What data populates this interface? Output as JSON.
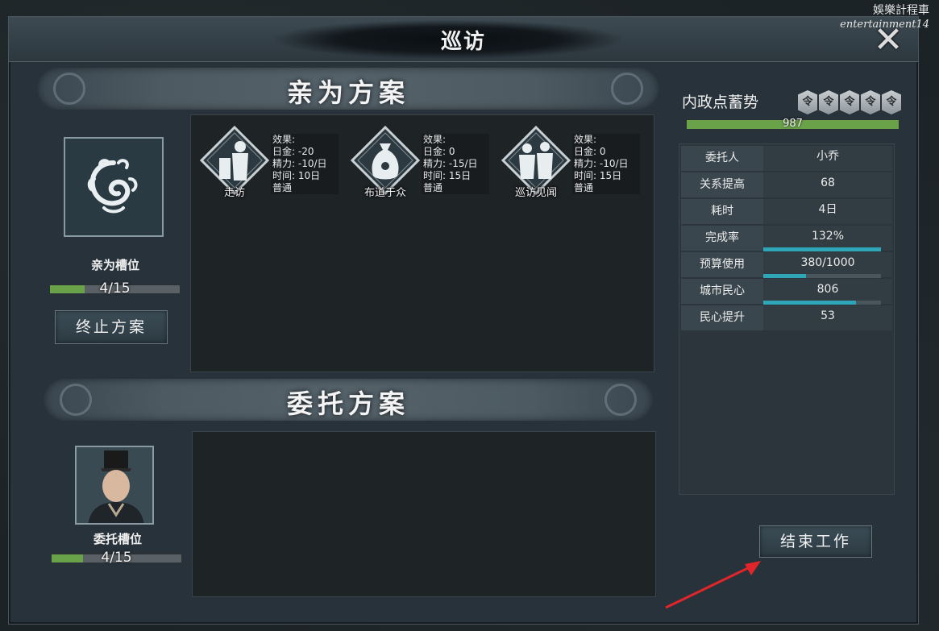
{
  "window": {
    "title": "巡访",
    "watermark_line1": "娛樂計程車",
    "watermark_line2": "entertainment14",
    "close_glyph": "✕"
  },
  "personal": {
    "header": "亲为方案",
    "slot_label": "亲为槽位",
    "progress_text": "4/15",
    "progress_fraction": 0.27,
    "stop_button": "终止方案",
    "plans": [
      {
        "name": "走访",
        "icon": "visitor-figure-icon",
        "stats": [
          "效果:",
          "日金: -20",
          "精力: -10/日",
          "时间: 10日",
          "普通"
        ]
      },
      {
        "name": "布道于众",
        "icon": "money-bag-icon",
        "stats": [
          "效果:",
          "日金: 0",
          "精力: -15/日",
          "时间: 15日",
          "普通"
        ]
      },
      {
        "name": "巡访见闻",
        "icon": "two-figures-icon",
        "stats": [
          "效果:",
          "日金: 0",
          "精力: -10/日",
          "时间: 15日",
          "普通"
        ]
      }
    ]
  },
  "delegate": {
    "header": "委托方案",
    "slot_label": "委托槽位",
    "progress_text": "4/15",
    "progress_fraction": 0.24
  },
  "domestic": {
    "label": "内政点蓄势",
    "tokens": [
      "令",
      "令",
      "令",
      "令",
      "令"
    ],
    "value": "987",
    "fraction": 1.0
  },
  "info_rows": [
    {
      "key": "委托人",
      "value": "小乔",
      "bar": null
    },
    {
      "key": "关系提高",
      "value": "68",
      "bar": null
    },
    {
      "key": "耗时",
      "value": "4日",
      "bar": null
    },
    {
      "key": "完成率",
      "value": "132%",
      "bar": 1.0
    },
    {
      "key": "预算使用",
      "value": "380/1000",
      "bar": 0.36
    },
    {
      "key": "城市民心",
      "value": "806",
      "bar": 0.79
    },
    {
      "key": "民心提升",
      "value": "53",
      "bar": null
    }
  ],
  "end_button": "结束工作",
  "colors": {
    "progress_green": "#6aa24a",
    "bar_teal": "#2fa6b8",
    "annotation_arrow": "#e0262a"
  }
}
